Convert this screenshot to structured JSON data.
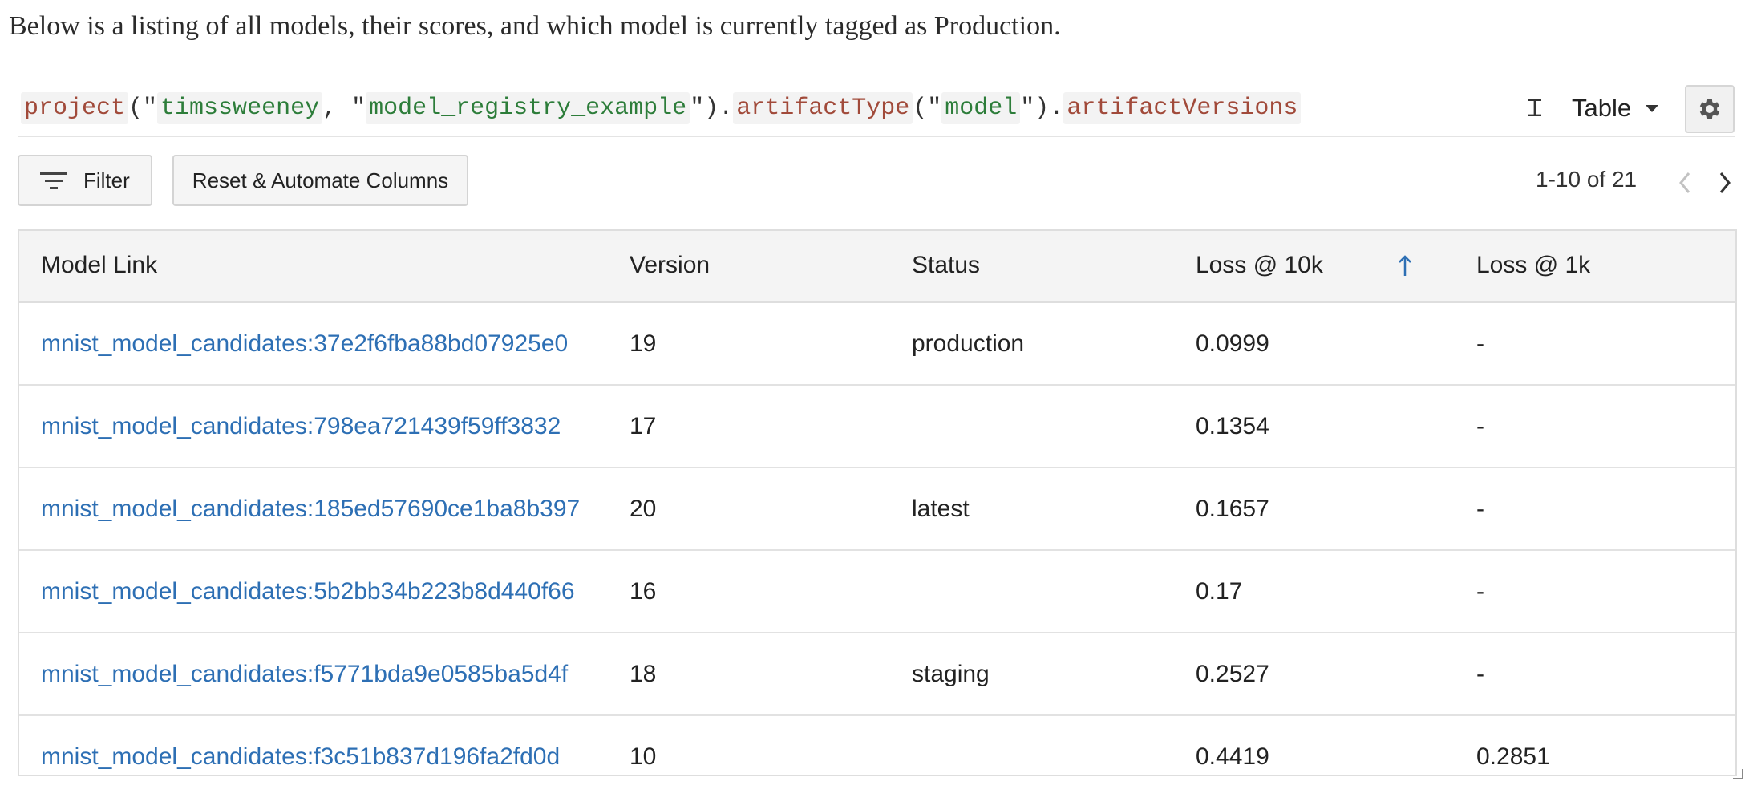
{
  "intro_text": "Below is a listing of all models, their scores, and which model is currently tagged as Production.",
  "query": {
    "fn1": "project",
    "arg1": "timssweeney",
    "sep": ", \"",
    "arg2": "model_registry_example",
    "fn2": "artifactType",
    "arg3": "model",
    "fn3": "artifactVersions",
    "open_quote": "(\"",
    "close_quote": "\")",
    "dot": "."
  },
  "toolbar": {
    "view_label": "Table",
    "filter_label": "Filter",
    "reset_label": "Reset & Automate Columns",
    "pagination": "1-10 of 21"
  },
  "table": {
    "headers": [
      "Model Link",
      "Version",
      "Status",
      "Loss @ 10k",
      "Loss @ 1k"
    ],
    "rows": [
      {
        "link": "mnist_model_candidates:37e2f6fba88bd07925e0",
        "version": "19",
        "status": "production",
        "loss10k": "0.0999",
        "loss1k": "-"
      },
      {
        "link": "mnist_model_candidates:798ea721439f59ff3832",
        "version": "17",
        "status": "",
        "loss10k": "0.1354",
        "loss1k": "-"
      },
      {
        "link": "mnist_model_candidates:185ed57690ce1ba8b397",
        "version": "20",
        "status": "latest",
        "loss10k": "0.1657",
        "loss1k": "-"
      },
      {
        "link": "mnist_model_candidates:5b2bb34b223b8d440f66",
        "version": "16",
        "status": "",
        "loss10k": "0.17",
        "loss1k": "-"
      },
      {
        "link": "mnist_model_candidates:f5771bda9e0585ba5d4f",
        "version": "18",
        "status": "staging",
        "loss10k": "0.2527",
        "loss1k": "-"
      },
      {
        "link": "mnist_model_candidates:f3c51b837d196fa2fd0d",
        "version": "10",
        "status": "",
        "loss10k": "0.4419",
        "loss1k": "0.2851"
      }
    ]
  },
  "colors": {
    "link": "#2d6fb4",
    "accent": "#2d6fb4"
  },
  "icons": [
    "text-cursor-icon",
    "chevron-down-icon",
    "gear-icon",
    "filter-lines-icon",
    "chevron-left-icon",
    "chevron-right-icon",
    "arrow-up-icon"
  ]
}
